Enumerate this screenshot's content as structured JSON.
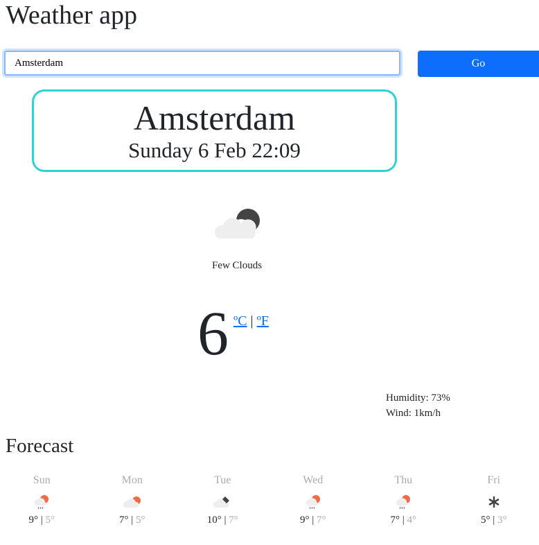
{
  "app": {
    "title": "Weather app"
  },
  "search": {
    "value": "Amsterdam",
    "button": "Go"
  },
  "current": {
    "city": "Amsterdam",
    "date": "Sunday 6 Feb 22:09",
    "icon": "few-clouds-night-icon",
    "description": "Few Clouds",
    "temperature": "6",
    "unit_c": "ºC",
    "unit_sep": "|",
    "unit_f": "ºF",
    "humidity": "Humidity: 73%",
    "wind": "Wind: 1km/h"
  },
  "forecast": {
    "title": "Forecast",
    "days": [
      {
        "day": "Sun",
        "icon": "rain-day-icon",
        "high": "9°",
        "low": "5°"
      },
      {
        "day": "Mon",
        "icon": "cloudy-day-icon",
        "high": "7°",
        "low": "5°"
      },
      {
        "day": "Tue",
        "icon": "cloudy-dark-icon",
        "high": "10°",
        "low": "7°"
      },
      {
        "day": "Wed",
        "icon": "rain-day-icon",
        "high": "9°",
        "low": "7°"
      },
      {
        "day": "Thu",
        "icon": "rain-day-icon",
        "high": "7°",
        "low": "4°"
      },
      {
        "day": "Fri",
        "icon": "snow-icon",
        "high": "5°",
        "low": "3°"
      }
    ]
  },
  "colors": {
    "accent": "#0d6efd",
    "card_border": "#2ed3d1",
    "sun": "#f26b47",
    "moon": "#444444",
    "cloud": "#eeeeee"
  }
}
